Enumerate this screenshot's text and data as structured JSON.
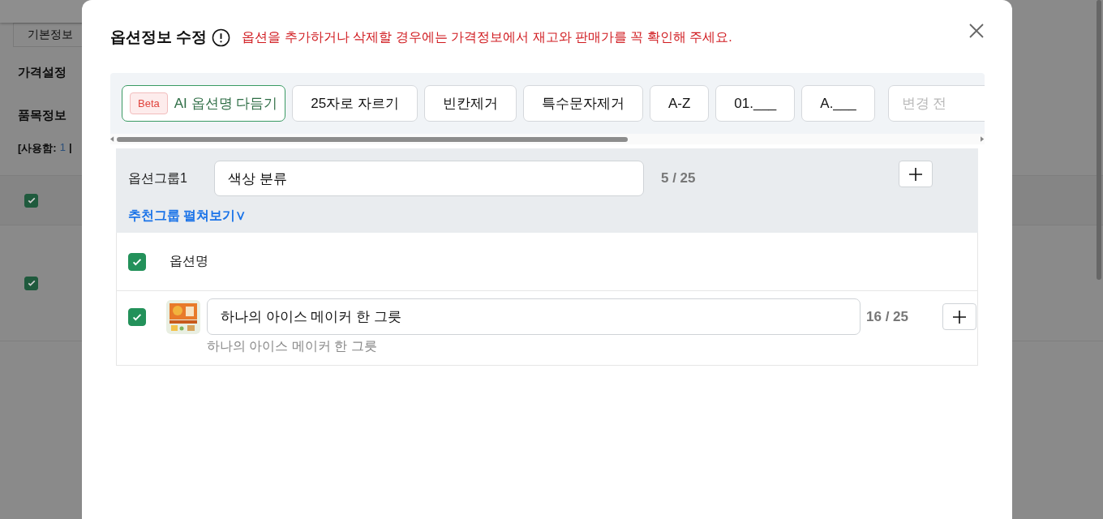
{
  "background_page": {
    "tab": "기본정보",
    "price_heading": "가격설정",
    "items_heading": "품목정보",
    "usage": {
      "prefix": "[사용함:",
      "count": "1",
      "suffix": "|"
    },
    "table": {
      "header_checked": true,
      "rows": [
        {
          "checked": true
        }
      ]
    }
  },
  "dialog": {
    "title": "옵션정보 수정",
    "warning": "옵션을 추가하거나 삭제할 경우에는 가격정보에서 재고와 판매가를 꼭 확인해 주세요.",
    "toolbar": {
      "buttons": [
        {
          "kind": "ai",
          "badge": "Beta",
          "label": "AI 옵션명 다듬기"
        },
        {
          "kind": "plain",
          "label": "25자로 자르기"
        },
        {
          "kind": "plain",
          "label": "빈칸제거"
        },
        {
          "kind": "plain",
          "label": "특수문자제거"
        },
        {
          "kind": "plain",
          "label": "A-Z"
        },
        {
          "kind": "plain",
          "label": "01.___"
        },
        {
          "kind": "plain",
          "label": "A.___"
        }
      ],
      "input_placeholder": "변경 전"
    },
    "option_group": {
      "label": "옵션그룹1",
      "value": "색상 분류",
      "count": "5 / 25",
      "expand_link": "추천그룹 펼쳐보기∨"
    },
    "options": {
      "header": {
        "checked": true,
        "label": "옵션명"
      },
      "rows": [
        {
          "checked": true,
          "value": "하나의 아이스 메이커 한 그릇",
          "count": "16 / 25",
          "original": "하나의 아이스 메이커 한 그릇"
        }
      ]
    }
  }
}
